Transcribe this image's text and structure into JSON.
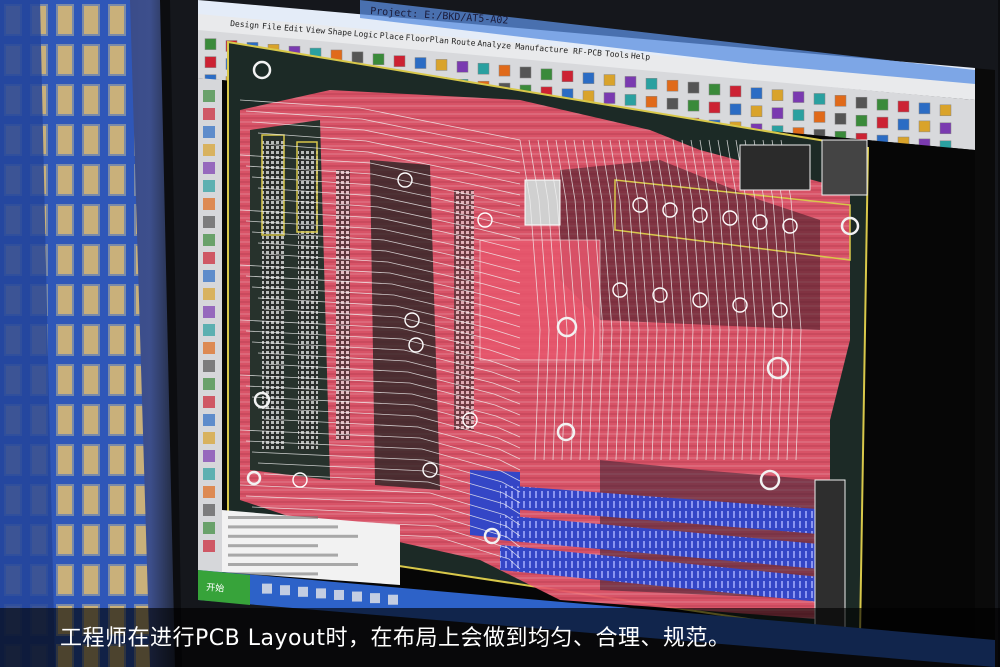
{
  "window": {
    "title": "Project: E:/BKD/AT5-A02",
    "menu": [
      "Design",
      "File",
      "Edit",
      "View",
      "Shape",
      "Logic",
      "Place",
      "FloorPlan",
      "Route",
      "Analyze",
      "Manufacture",
      "RF-PCB",
      "Tools",
      "Help"
    ]
  },
  "taskbar": {
    "start_label": "开始"
  },
  "caption": "工程师在进行PCB Layout时，在布局上会做到均匀、合理、规范。",
  "colors": {
    "trace_red": "#e8576d",
    "trace_white": "#f2f2f2",
    "board_dark": "#1c2a26",
    "trace_blue": "#3a4ccc",
    "trace_yellow": "#d8c84a",
    "toolbar": "#d8d9dc"
  }
}
